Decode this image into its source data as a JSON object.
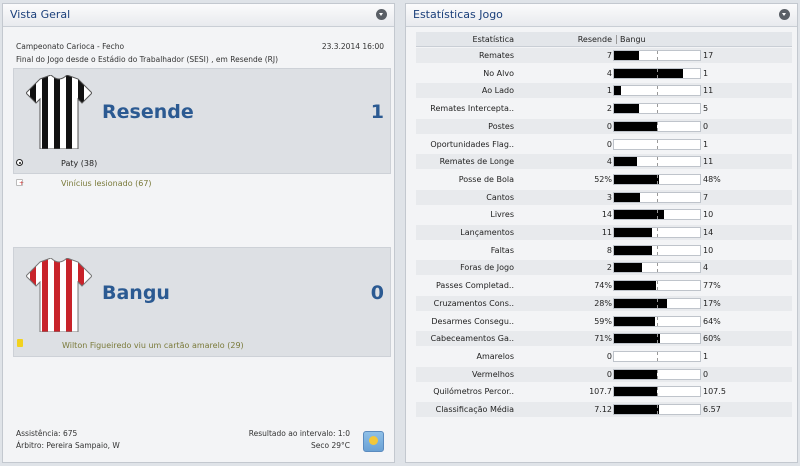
{
  "overview": {
    "title": "Vista Geral",
    "competition": "Campeonato Carioca - Fecho",
    "date": "23.3.2014 16:00",
    "venue": "Final do Jogo desde o Estádio do Trabalhador (SESI) , em Resende (RJ)",
    "home": {
      "name": "Resende",
      "score": "1",
      "kit": "black-white-stripes",
      "events": [
        {
          "icon": "goal-icon",
          "text": "Paty (38)"
        },
        {
          "icon": "injury-icon",
          "text": "Vinícius lesionado (67)"
        }
      ]
    },
    "away": {
      "name": "Bangu",
      "score": "0",
      "kit": "red-white-stripes",
      "events": [
        {
          "icon": "yellow-card-icon",
          "text": "Wilton Figueiredo viu um cartão amarelo (29)"
        }
      ]
    },
    "attendance": "Assistência: 675",
    "referee": "Árbitro: Pereira Sampaio, W",
    "halftime": "Resultado ao intervalo: 1:0",
    "weather": "Seco 29°C"
  },
  "stats": {
    "title": "Estatísticas Jogo",
    "col_stat": "Estatística",
    "col_home": "Resende",
    "col_away": "Bangu",
    "rows": [
      {
        "label": "Remates",
        "home": "7",
        "away": "17",
        "share": 0.29
      },
      {
        "label": "No Alvo",
        "home": "4",
        "away": "1",
        "share": 0.8
      },
      {
        "label": "Ao Lado",
        "home": "1",
        "away": "11",
        "share": 0.08
      },
      {
        "label": "Remates Intercepta..",
        "home": "2",
        "away": "5",
        "share": 0.29
      },
      {
        "label": "Postes",
        "home": "0",
        "away": "0",
        "share": 0.5
      },
      {
        "label": "Oportunidades Flag..",
        "home": "0",
        "away": "1",
        "share": 0
      },
      {
        "label": "Remates de Longe",
        "home": "4",
        "away": "11",
        "share": 0.27
      },
      {
        "label": "Posse de Bola",
        "home": "52%",
        "away": "48%",
        "share": 0.52
      },
      {
        "label": "Cantos",
        "home": "3",
        "away": "7",
        "share": 0.3
      },
      {
        "label": "Livres",
        "home": "14",
        "away": "10",
        "share": 0.58
      },
      {
        "label": "Lançamentos",
        "home": "11",
        "away": "14",
        "share": 0.44
      },
      {
        "label": "Faltas",
        "home": "8",
        "away": "10",
        "share": 0.44
      },
      {
        "label": "Foras de Jogo",
        "home": "2",
        "away": "4",
        "share": 0.33
      },
      {
        "label": "Passes Completad..",
        "home": "74%",
        "away": "77%",
        "share": 0.49
      },
      {
        "label": "Cruzamentos Cons..",
        "home": "28%",
        "away": "17%",
        "share": 0.62
      },
      {
        "label": "Desarmes Consegu..",
        "home": "59%",
        "away": "64%",
        "share": 0.48
      },
      {
        "label": "Cabeceamentos Ga..",
        "home": "71%",
        "away": "60%",
        "share": 0.54
      },
      {
        "label": "Amarelos",
        "home": "0",
        "away": "1",
        "share": 0
      },
      {
        "label": "Vermelhos",
        "home": "0",
        "away": "0",
        "share": 0.5
      },
      {
        "label": "Quilómetros Percor..",
        "home": "107.7",
        "away": "107.5",
        "share": 0.5
      },
      {
        "label": "Classificação Média",
        "home": "7.12",
        "away": "6.57",
        "share": 0.52
      }
    ]
  }
}
